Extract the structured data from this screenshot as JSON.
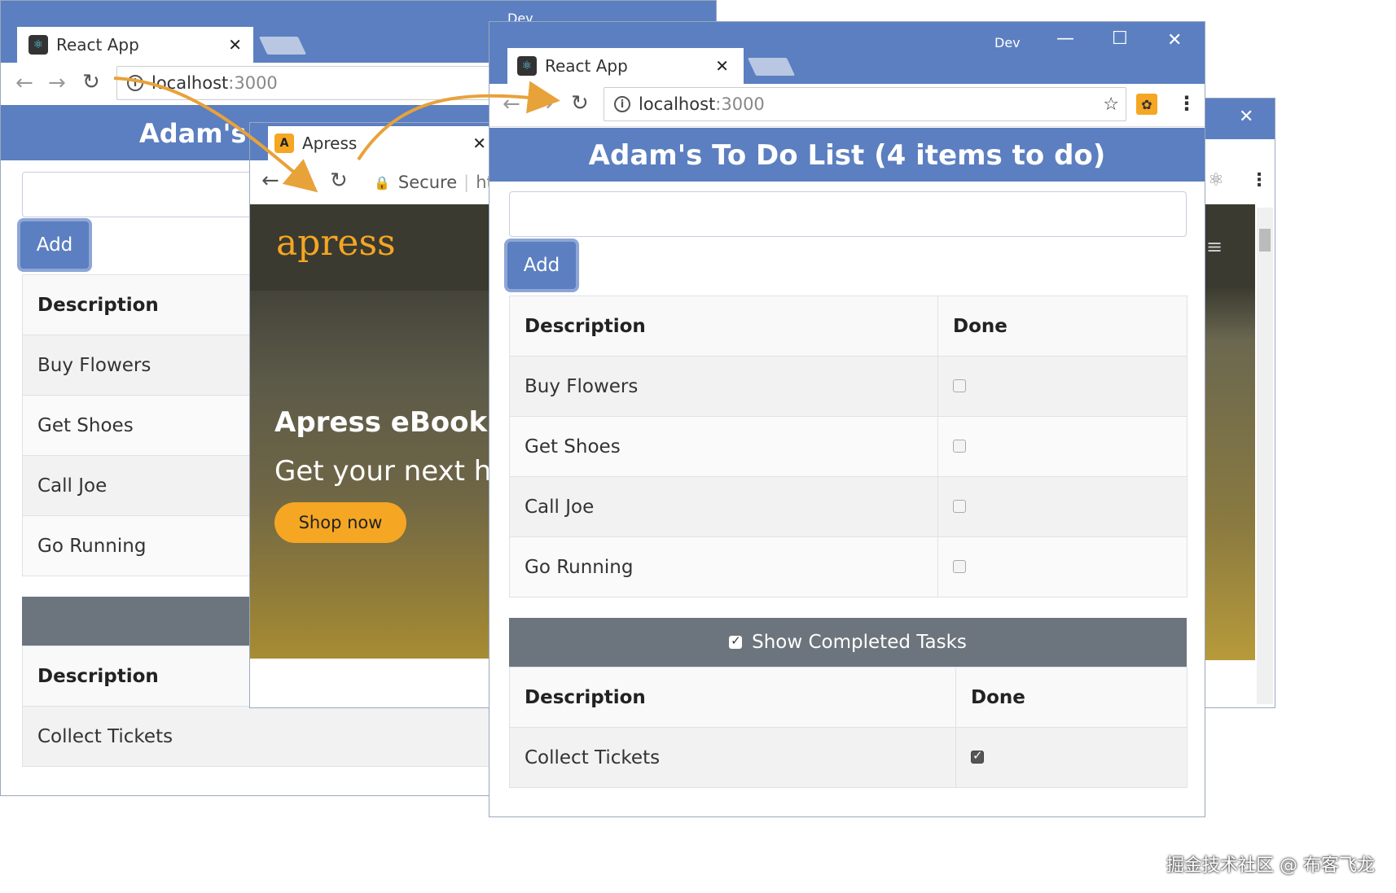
{
  "back_window": {
    "tab_title": "React App",
    "url_host": "localhost",
    "url_port": ":3000",
    "header_title": "Adam's ",
    "add_label": "Add",
    "table_header": "Description",
    "items": [
      "Buy Flowers",
      "Get Shoes",
      "Call Joe",
      "Go Running"
    ],
    "completed_header": "Description",
    "completed_items": [
      "Collect Tickets"
    ],
    "dev_label": "Dev"
  },
  "apress_window": {
    "tab_title": "Apress",
    "secure_label": "Secure",
    "url_fragment": "htt",
    "logo": "apress",
    "banner_title": "Apress eBook Sur",
    "banner_subtitle": "Get your next hot r",
    "cta_label": "Shop now"
  },
  "front_window": {
    "dev_label": "Dev",
    "tab_title": "React App",
    "url_host": "localhost",
    "url_port": ":3000",
    "header_title": "Adam's To Do List (4 items to do)",
    "add_label": "Add",
    "columns": [
      "Description",
      "Done"
    ],
    "items": [
      {
        "description": "Buy Flowers",
        "done": false
      },
      {
        "description": "Get Shoes",
        "done": false
      },
      {
        "description": "Call Joe",
        "done": false
      },
      {
        "description": "Go Running",
        "done": false
      }
    ],
    "show_completed_label": "Show Completed Tasks",
    "show_completed_checked": true,
    "completed_columns": [
      "Description",
      "Done"
    ],
    "completed_items": [
      {
        "description": "Collect Tickets",
        "done": true
      }
    ]
  },
  "watermark": "掘金技术社区 @ 布客飞龙",
  "colors": {
    "brand_blue": "#5b7fc0",
    "arrow_orange": "#e8a23a",
    "apress_orange": "#f5a623",
    "show_bar_gray": "#6c757d"
  }
}
